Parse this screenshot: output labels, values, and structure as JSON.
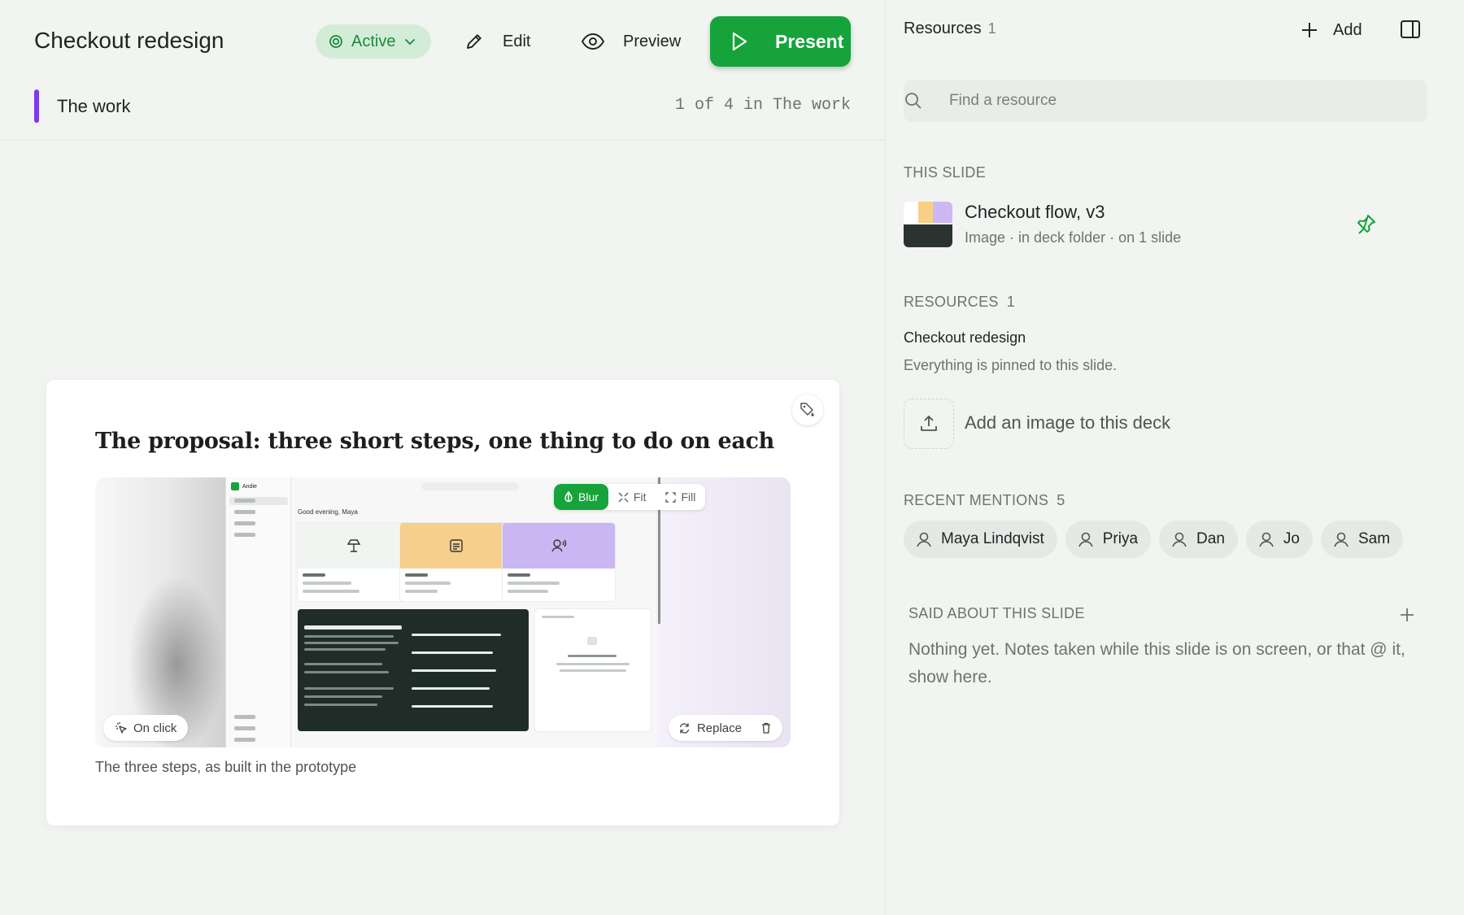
{
  "header": {
    "deck_title": "Checkout redesign",
    "status_label": "Active",
    "edit_label": "Edit",
    "preview_label": "Preview",
    "present_label": "Present",
    "section_name": "The work",
    "slide_counter": "1 of 4 in The work",
    "section_color": "#7c3aed"
  },
  "slide": {
    "heading": "The proposal: three short steps, one thing to do on each",
    "caption": "The three steps, as built in the prototype",
    "image_controls": {
      "blur_label": "Blur",
      "fit_label": "Fit",
      "fill_label": "Fill",
      "active": "Blur"
    },
    "on_click_label": "On click",
    "replace_label": "Replace",
    "embedded_image": {
      "app_name": "Andie",
      "greeting": "Good evening, Maya"
    }
  },
  "panel": {
    "title": "Resources",
    "title_count": "1",
    "add_label": "Add",
    "search_placeholder": "Find a resource",
    "this_slide_label": "THIS SLIDE",
    "this_slide_resource": {
      "name": "Checkout flow, v3",
      "meta": "Image · in deck folder · on 1 slide",
      "pinned": true
    },
    "resources_label": "RESOURCES",
    "resources_count": "1",
    "resource_group_name": "Checkout redesign",
    "resource_group_note": "Everything is pinned to this slide.",
    "upload_label": "Add an image to this deck",
    "recent_mentions_label": "RECENT MENTIONS",
    "recent_mentions_count": "5",
    "mentions": [
      "Maya Lindqvist",
      "Priya",
      "Dan",
      "Jo",
      "Sam"
    ],
    "said_label": "SAID ABOUT THIS SLIDE",
    "said_text": "Nothing yet. Notes taken while this slide is on screen, or that @ it, show here."
  },
  "colors": {
    "accent": "#16a33b",
    "status_bg": "#d3ecd8",
    "background": "#f1f4f1"
  },
  "icons": [
    "status-dot-icon",
    "chevron-down-icon",
    "pencil-icon",
    "eye-icon",
    "play-icon",
    "palette-icon",
    "drop-icon",
    "fit-icon",
    "fill-icon",
    "cursor-click-icon",
    "refresh-icon",
    "trash-icon",
    "plus-icon",
    "panel-toggle-icon",
    "search-icon",
    "pin-icon",
    "upload-icon",
    "person-icon"
  ]
}
